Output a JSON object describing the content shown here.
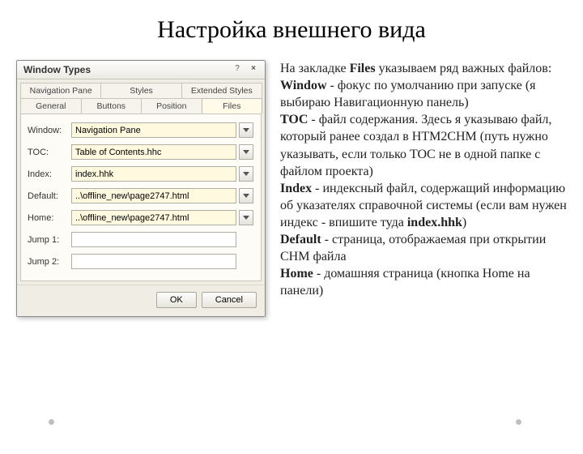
{
  "title": "Настройка внешнего вида",
  "window": {
    "title": "Window Types",
    "tabs_row1": [
      "Navigation Pane",
      "Styles",
      "Extended Styles"
    ],
    "tabs_row2": [
      "General",
      "Buttons",
      "Position",
      "Files"
    ],
    "active_tab": "Files",
    "fields": {
      "window": {
        "label": "Window:",
        "value": "Navigation Pane",
        "highlight": true,
        "combo": true
      },
      "toc": {
        "label": "TOC:",
        "value": "Table of Contents.hhc",
        "highlight": true,
        "combo": true
      },
      "index": {
        "label": "Index:",
        "value": "index.hhk",
        "highlight": true,
        "combo": true
      },
      "default": {
        "label": "Default:",
        "value": "..\\offline_new\\page2747.html",
        "highlight": true,
        "combo": true
      },
      "home": {
        "label": "Home:",
        "value": "..\\offline_new\\page2747.html",
        "highlight": true,
        "combo": true
      },
      "jump1": {
        "label": "Jump 1:",
        "value": "",
        "highlight": false,
        "combo": false
      },
      "jump2": {
        "label": "Jump 2:",
        "value": "",
        "highlight": false,
        "combo": false
      }
    },
    "buttons": {
      "ok": "OK",
      "cancel": "Cancel"
    }
  },
  "desc": {
    "p1a": "На закладке ",
    "p1b": "Files",
    "p1c": " указываем ряд важных файлов:",
    "w_b": "Window",
    "w_t": " - фокус по умолчанию при запуске (я выбираю Навигационную панель)",
    "t_b": "TOC",
    "t_t": " - файл содержания. Здесь я указываю файл, который ранее создал в HTM2CHM (путь нужно указывать, если только TOC не в одной папке с файлом проекта)",
    "i_b": "Index",
    "i_t1": " - индексный файл, содержащий информацию об указателях справочной системы (если вам нужен индекс - впишите туда ",
    "i_b2": "index.hhk",
    "i_t2": ")",
    "d_b": "Default",
    "d_t": " - страница, отображаемая при открытии CHM файла",
    "h_b": "Home",
    "h_t": " - домашняя страница (кнопка Home на панели)"
  }
}
